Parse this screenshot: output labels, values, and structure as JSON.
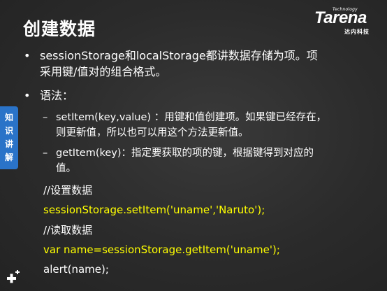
{
  "slide": {
    "title": "创建数据",
    "logo": {
      "tech": "Technology",
      "main": "Tarena",
      "sub": "达内科技"
    },
    "side_tab": [
      "知",
      "识",
      "讲",
      "解"
    ],
    "bullets": [
      {
        "lines": [
          "sessionStorage和localStorage都讲数据存储为项。项",
          "采用键/值对的组合格式。"
        ]
      },
      {
        "lines": [
          "语法："
        ]
      }
    ],
    "sub_bullets": [
      {
        "lines": [
          "setItem(key,value) ：用键和值创建项。如果键已经存在，",
          "则更新值，所以也可以用这个方法更新值。"
        ]
      },
      {
        "lines": [
          "getItem(key)：指定要获取的项的键，根据键得到对应的",
          "值。"
        ]
      }
    ],
    "code": [
      {
        "text": "//设置数据",
        "style": "comment"
      },
      {
        "text": "sessionStorage.setItem('uname','Naruto');",
        "style": "yellow"
      },
      {
        "text": "//读取数据",
        "style": "comment"
      },
      {
        "text": "var name=sessionStorage.getItem('uname');",
        "style": "yellow"
      },
      {
        "text": "alert(name);",
        "style": "white"
      }
    ]
  }
}
